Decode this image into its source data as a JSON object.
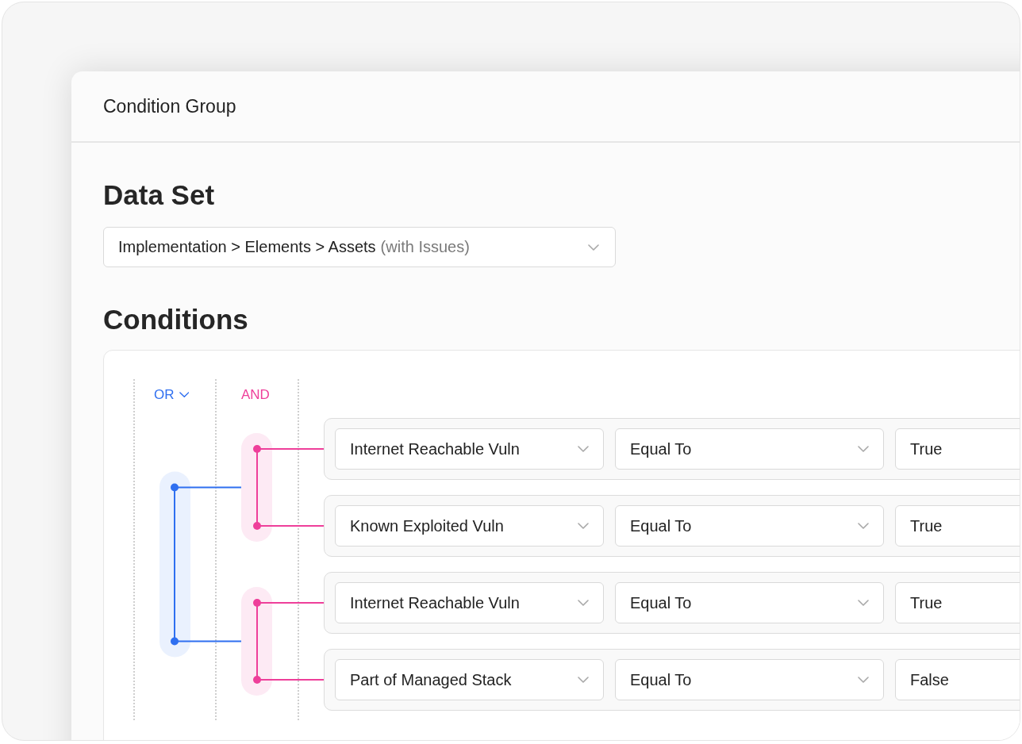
{
  "panel": {
    "title": "Condition Group"
  },
  "data_set": {
    "heading": "Data Set",
    "value": "Implementation > Elements > Assets",
    "qualifier": "(with Issues)"
  },
  "conditions": {
    "heading": "Conditions",
    "or_label": "OR",
    "and_label": "AND",
    "groups": [
      {
        "rows": [
          {
            "field": "Internet Reachable Vuln",
            "operator": "Equal To",
            "value": "True"
          },
          {
            "field": "Known Exploited Vuln",
            "operator": "Equal To",
            "value": "True"
          }
        ]
      },
      {
        "rows": [
          {
            "field": "Internet Reachable Vuln",
            "operator": "Equal To",
            "value": "True"
          },
          {
            "field": "Part of Managed Stack",
            "operator": "Equal To",
            "value": "False"
          }
        ]
      }
    ]
  }
}
